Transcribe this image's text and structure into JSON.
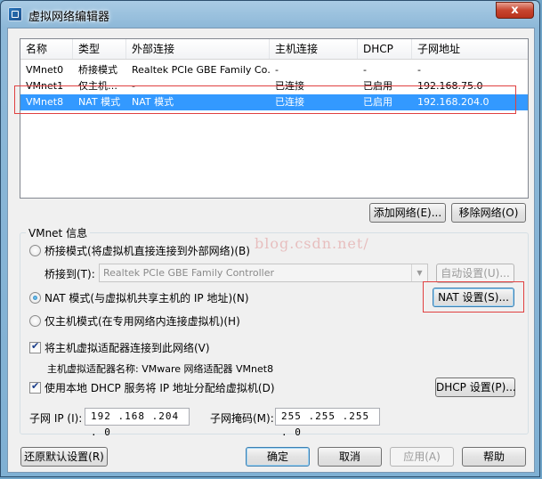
{
  "window": {
    "title": "虚拟网络编辑器",
    "close_symbol": "x"
  },
  "table": {
    "columns": [
      "名称",
      "类型",
      "外部连接",
      "主机连接",
      "DHCP",
      "子网地址"
    ],
    "rows": [
      [
        "VMnet0",
        "桥接模式",
        "Realtek PCIe GBE Family Co…",
        "-",
        "-",
        "-"
      ],
      [
        "VMnet1",
        "仅主机…",
        "-",
        "已连接",
        "已启用",
        "192.168.75.0"
      ],
      [
        "VMnet8",
        "NAT 模式",
        "NAT 模式",
        "已连接",
        "已启用",
        "192.168.204.0"
      ]
    ],
    "selected_row": 2
  },
  "list_buttons": {
    "add": "添加网络(E)...",
    "remove": "移除网络(O)"
  },
  "group": {
    "title": "VMnet 信息",
    "watermark": "blog.csdn.net/",
    "bridge_radio": "桥接模式(将虚拟机直接连接到外部网络)(B)",
    "bridge_to_label": "桥接到(T):",
    "bridge_to_value": "Realtek PCIe GBE Family Controller",
    "auto_settings": "自动设置(U)...",
    "nat_radio": "NAT 模式(与虚拟机共享主机的 IP 地址)(N)",
    "nat_settings": "NAT 设置(S)...",
    "hostonly_radio": "仅主机模式(在专用网络内连接虚拟机)(H)",
    "connect_adapter": "将主机虚拟适配器连接到此网络(V)",
    "adapter_name": "主机虚拟适配器名称: VMware 网络适配器 VMnet8",
    "use_dhcp": "使用本地 DHCP 服务将 IP 地址分配给虚拟机(D)",
    "dhcp_settings": "DHCP 设置(P)...",
    "subnet_ip_label": "子网 IP (I):",
    "subnet_ip_value": "192 .168 .204 . 0",
    "subnet_mask_label": "子网掩码(M):",
    "subnet_mask_value": "255 .255 .255 . 0",
    "selected_mode": "nat",
    "connect_adapter_checked": true,
    "use_dhcp_checked": true
  },
  "footer": {
    "restore": "还原默认设置(R)",
    "ok": "确定",
    "cancel": "取消",
    "apply": "应用(A)",
    "help": "帮助"
  },
  "colors": {
    "selection": "#3399ff",
    "highlight_box": "#e04040"
  }
}
